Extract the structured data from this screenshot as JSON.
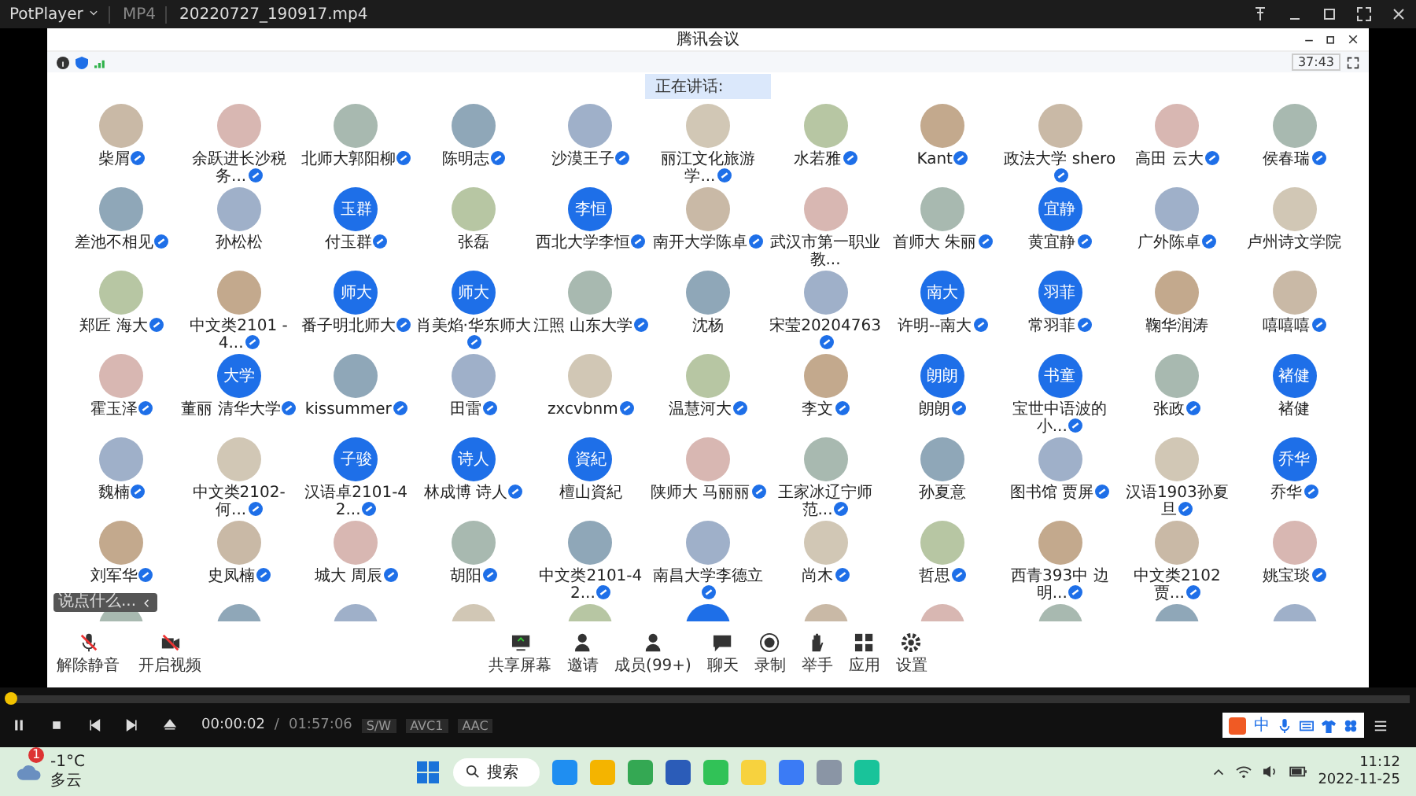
{
  "player": {
    "app": "PotPlayer",
    "format": "MP4",
    "file": "20220727_190917.mp4"
  },
  "meeting": {
    "title": "腾讯会议",
    "timer": "37:43",
    "speaking": "正在讲话:",
    "chat_placeholder": "说点什么...",
    "participants": [
      {
        "name": "柴屑",
        "kind": "photo",
        "verified": true
      },
      {
        "name": "余跃进长沙税务...",
        "kind": "photo",
        "verified": true
      },
      {
        "name": "北师大郭阳柳",
        "kind": "photo",
        "verified": true
      },
      {
        "name": "陈明志",
        "kind": "photo",
        "verified": true
      },
      {
        "name": "沙漠王子",
        "kind": "photo",
        "verified": true
      },
      {
        "name": "丽江文化旅游学...",
        "kind": "photo",
        "verified": true
      },
      {
        "name": "水若雅",
        "kind": "photo",
        "verified": true
      },
      {
        "name": "Kant",
        "kind": "photo",
        "verified": true
      },
      {
        "name": "政法大学 shero",
        "kind": "photo",
        "verified": true
      },
      {
        "name": "高田 云大",
        "kind": "photo",
        "verified": true
      },
      {
        "name": "侯春瑞",
        "kind": "photo",
        "verified": true
      },
      {
        "name": "差池不相见",
        "kind": "photo",
        "verified": true
      },
      {
        "name": "孙松松",
        "kind": "photo",
        "verified": false
      },
      {
        "name": "付玉群",
        "kind": "text",
        "avatar_text": "玉群",
        "verified": true
      },
      {
        "name": "张磊",
        "kind": "photo",
        "verified": false
      },
      {
        "name": "西北大学李恒",
        "kind": "text",
        "avatar_text": "李恒",
        "verified": true
      },
      {
        "name": "南开大学陈卓",
        "kind": "photo",
        "verified": true
      },
      {
        "name": "武汉市第一职业教...",
        "kind": "photo",
        "verified": false
      },
      {
        "name": "首师大 朱丽",
        "kind": "photo",
        "verified": true
      },
      {
        "name": "黄宜静",
        "kind": "text",
        "avatar_text": "宜静",
        "verified": true
      },
      {
        "name": "广外陈卓",
        "kind": "photo",
        "verified": true
      },
      {
        "name": "卢州诗文学院",
        "kind": "photo",
        "verified": false
      },
      {
        "name": "郑匠 海大",
        "kind": "photo",
        "verified": true
      },
      {
        "name": "中文类2101 - 4...",
        "kind": "photo",
        "verified": true
      },
      {
        "name": "番子明北师大",
        "kind": "text",
        "avatar_text": "师大",
        "verified": true
      },
      {
        "name": "肖美焰·华东师大",
        "kind": "text",
        "avatar_text": "师大",
        "verified": true
      },
      {
        "name": "江照 山东大学",
        "kind": "photo",
        "verified": true
      },
      {
        "name": "沈杨",
        "kind": "photo",
        "verified": false
      },
      {
        "name": "宋莹20204763",
        "kind": "photo",
        "verified": true
      },
      {
        "name": "许明--南大",
        "kind": "text",
        "avatar_text": "南大",
        "verified": true
      },
      {
        "name": "常羽菲",
        "kind": "text",
        "avatar_text": "羽菲",
        "verified": true
      },
      {
        "name": "鞠华润涛",
        "kind": "photo",
        "verified": false
      },
      {
        "name": "嘻嘻嘻",
        "kind": "photo",
        "verified": true
      },
      {
        "name": "霍玉泽",
        "kind": "photo",
        "verified": true
      },
      {
        "name": "董丽 清华大学",
        "kind": "text",
        "avatar_text": "大学",
        "verified": true
      },
      {
        "name": "kissummer",
        "kind": "photo",
        "verified": true
      },
      {
        "name": "田雷",
        "kind": "photo",
        "verified": true
      },
      {
        "name": "zxcvbnm",
        "kind": "photo",
        "verified": true
      },
      {
        "name": "温慧河大",
        "kind": "photo",
        "verified": true
      },
      {
        "name": "李文",
        "kind": "photo",
        "verified": true
      },
      {
        "name": "朗朗",
        "kind": "text",
        "avatar_text": "朗朗",
        "verified": true
      },
      {
        "name": "宝世中语波的小...",
        "kind": "text",
        "avatar_text": "书童",
        "verified": true
      },
      {
        "name": "张政",
        "kind": "photo",
        "verified": true
      },
      {
        "name": "褚健",
        "kind": "text",
        "avatar_text": "褚健",
        "verified": false
      },
      {
        "name": "魏楠",
        "kind": "photo",
        "verified": true
      },
      {
        "name": "中文类2102-何...",
        "kind": "photo",
        "verified": true
      },
      {
        "name": "汉语卓2101-42...",
        "kind": "text",
        "avatar_text": "子骏",
        "verified": true
      },
      {
        "name": "林成博 诗人",
        "kind": "text",
        "avatar_text": "诗人",
        "verified": true
      },
      {
        "name": "檀山資紀",
        "kind": "text",
        "avatar_text": "資紀",
        "verified": false
      },
      {
        "name": "陕师大 马丽丽",
        "kind": "photo",
        "verified": true
      },
      {
        "name": "王家冰辽宁师范...",
        "kind": "photo",
        "verified": true
      },
      {
        "name": "孙夏意",
        "kind": "photo",
        "verified": false
      },
      {
        "name": "图书馆 贾屏",
        "kind": "photo",
        "verified": true
      },
      {
        "name": "汉语1903孙夏旦",
        "kind": "photo",
        "verified": true
      },
      {
        "name": "乔华",
        "kind": "text",
        "avatar_text": "乔华",
        "verified": true
      },
      {
        "name": "刘军华",
        "kind": "photo",
        "verified": true
      },
      {
        "name": "史凤楠",
        "kind": "photo",
        "verified": true
      },
      {
        "name": "城大 周辰",
        "kind": "photo",
        "verified": true
      },
      {
        "name": "胡阳",
        "kind": "photo",
        "verified": true
      },
      {
        "name": "中文类2101-42...",
        "kind": "photo",
        "verified": true
      },
      {
        "name": "南昌大学李德立",
        "kind": "photo",
        "verified": true
      },
      {
        "name": "尚木",
        "kind": "photo",
        "verified": true
      },
      {
        "name": "哲思",
        "kind": "photo",
        "verified": true
      },
      {
        "name": "西青393中 边明...",
        "kind": "photo",
        "verified": true
      },
      {
        "name": "中文类2102 贾...",
        "kind": "photo",
        "verified": true
      },
      {
        "name": "姚宝琰",
        "kind": "photo",
        "verified": true
      }
    ],
    "toolbar_left": [
      {
        "label": "解除静音",
        "kind": "mic"
      },
      {
        "label": "开启视频",
        "kind": "camera"
      }
    ],
    "toolbar_center": [
      {
        "label": "共享屏幕",
        "kind": "share"
      },
      {
        "label": "邀请",
        "kind": "invite"
      },
      {
        "label": "成员(99+)",
        "kind": "members"
      },
      {
        "label": "聊天",
        "kind": "chat"
      },
      {
        "label": "录制",
        "kind": "record"
      },
      {
        "label": "举手",
        "kind": "hand"
      },
      {
        "label": "应用",
        "kind": "apps"
      },
      {
        "label": "设置",
        "kind": "settings"
      }
    ]
  },
  "playback": {
    "position": "00:00:02",
    "separator": "/",
    "duration": "01:57:06",
    "tags": [
      "S/W",
      "AVC1",
      "AAC"
    ],
    "level": 0.003
  },
  "ime": {
    "label": "中"
  },
  "taskbar": {
    "weather": {
      "temp": "-1°C",
      "desc": "多云",
      "badge": "1"
    },
    "search": "搜索",
    "time": "11:12",
    "date": "2022-11-25"
  }
}
